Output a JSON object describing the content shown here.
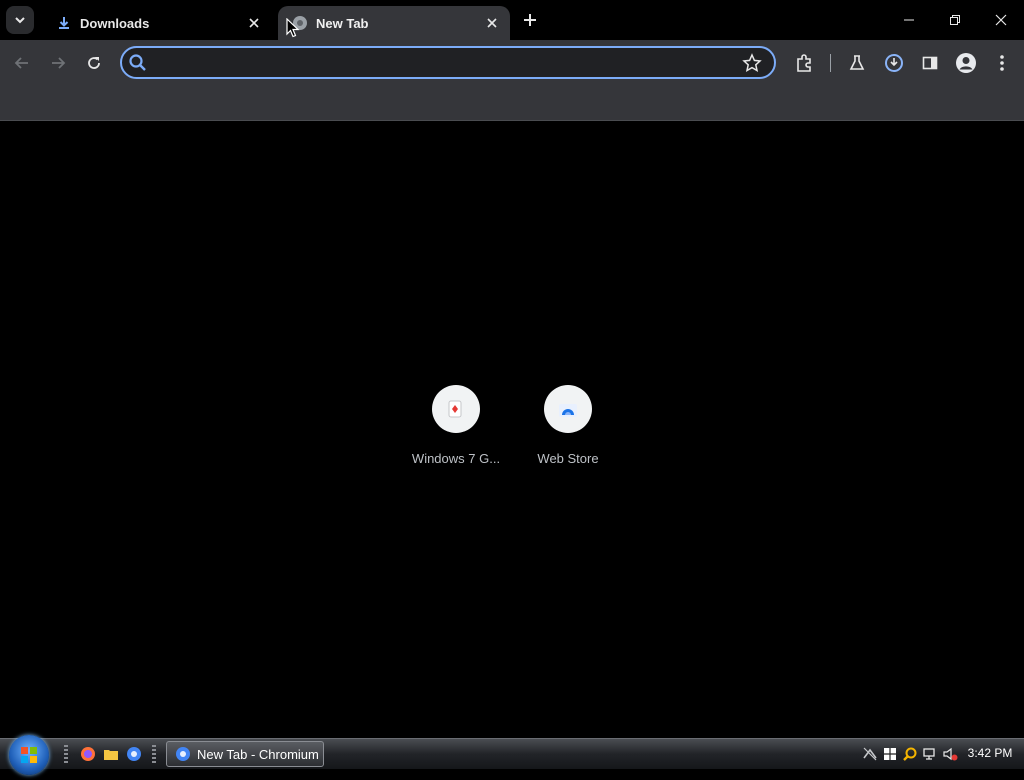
{
  "tabs": [
    {
      "label": "Downloads"
    },
    {
      "label": "New Tab"
    }
  ],
  "omnibox": {
    "value": "",
    "placeholder": ""
  },
  "shortcuts": [
    {
      "label": "Windows 7 G..."
    },
    {
      "label": "Web Store"
    }
  ],
  "taskbar": {
    "task_label": "New Tab - Chromium",
    "clock": "3:42 PM"
  },
  "colors": {
    "accent": "#7cacf8",
    "toolbar": "#35363a",
    "background": "#000000"
  },
  "icons": [
    "tab-search-icon",
    "download-icon",
    "close-icon",
    "new-tab-icon",
    "minimize-icon",
    "restore-icon",
    "back-icon",
    "forward-icon",
    "reload-icon",
    "search-icon",
    "star-icon",
    "extensions-icon",
    "labs-icon",
    "update-icon",
    "side-panel-icon",
    "profile-icon",
    "menu-icon",
    "firefox-icon",
    "folder-icon",
    "chromium-icon"
  ]
}
